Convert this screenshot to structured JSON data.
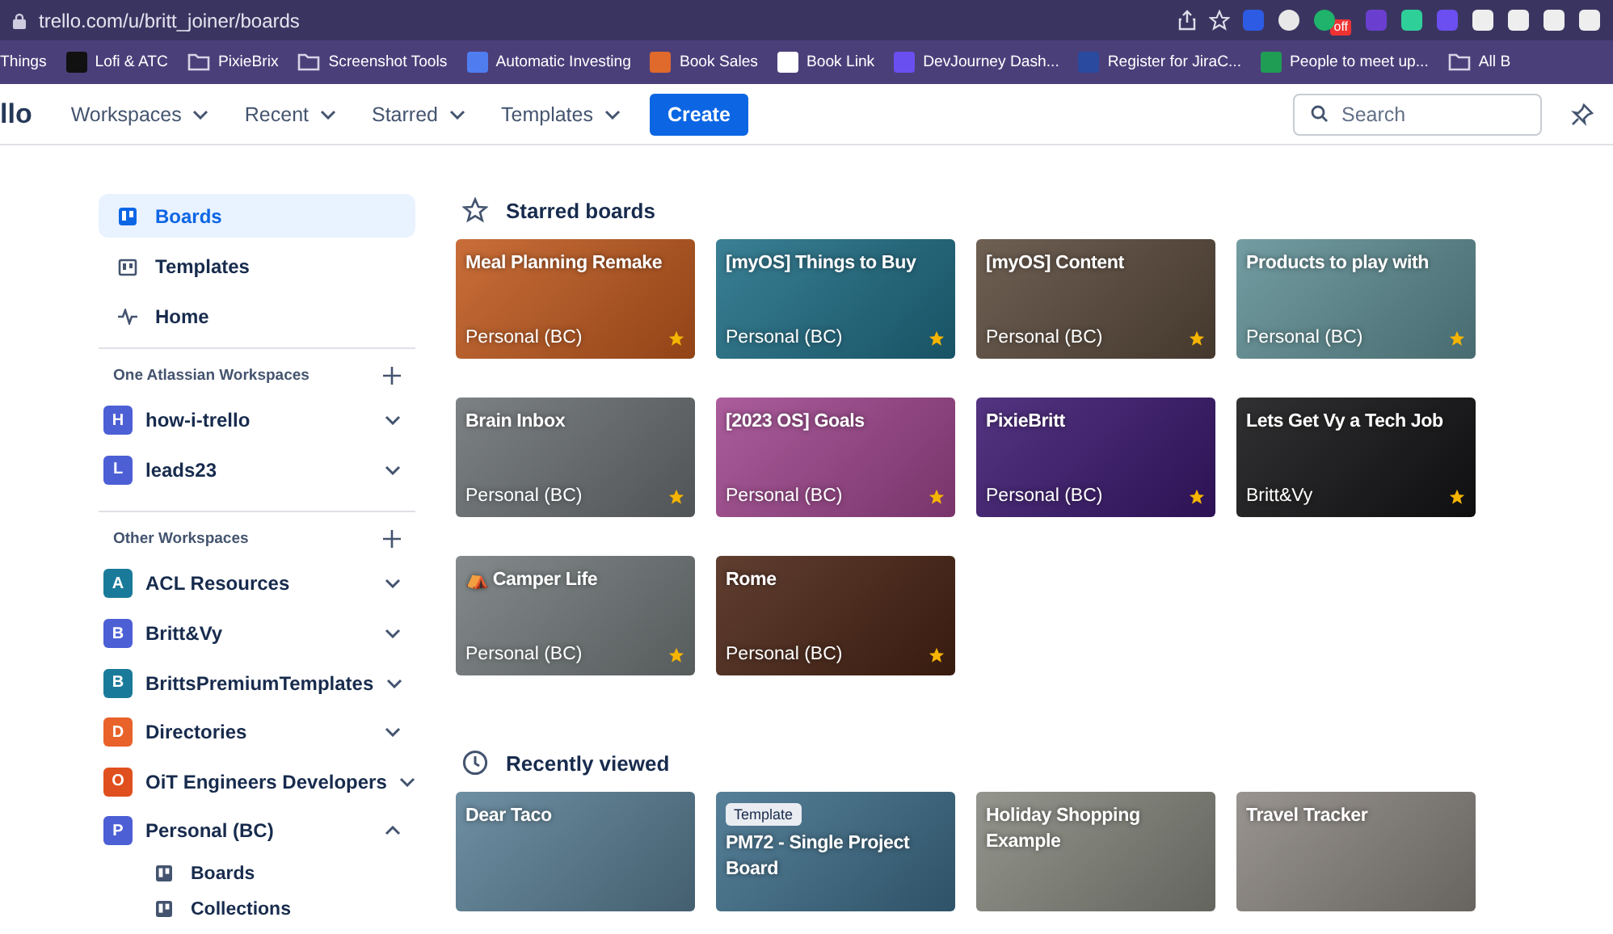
{
  "browser": {
    "url": "trello.com/u/britt_joiner/boards",
    "extension_badge": "off"
  },
  "bookmarks": [
    {
      "label": "Things",
      "kind": "plain"
    },
    {
      "label": "Lofi & ATC",
      "kind": "site",
      "color": "#111111"
    },
    {
      "label": "PixieBrix",
      "kind": "folder",
      "color": "#d8d4e6"
    },
    {
      "label": "Screenshot Tools",
      "kind": "folder",
      "color": "#d8d4e6"
    },
    {
      "label": "Automatic Investing",
      "kind": "site",
      "color": "#4f7df0"
    },
    {
      "label": "Book Sales",
      "kind": "site",
      "color": "#e0692c"
    },
    {
      "label": "Book Link",
      "kind": "site",
      "color": "#ffffff"
    },
    {
      "label": "DevJourney Dash...",
      "kind": "site",
      "color": "#6a4ff0"
    },
    {
      "label": "Register for JiraC...",
      "kind": "site",
      "color": "#2a4aa0"
    },
    {
      "label": "People to meet up...",
      "kind": "site",
      "color": "#1f9d55"
    },
    {
      "label": "All B",
      "kind": "folder",
      "color": "#d8d4e6"
    }
  ],
  "nav": {
    "logo": "llo",
    "menus": [
      "Workspaces",
      "Recent",
      "Starred",
      "Templates"
    ],
    "create": "Create",
    "search": {
      "placeholder": "Search"
    }
  },
  "sidebar": {
    "items": [
      {
        "label": "Boards",
        "kind": "boards",
        "selected": true
      },
      {
        "label": "Templates",
        "kind": "templates",
        "selected": false
      },
      {
        "label": "Home",
        "kind": "home",
        "selected": false
      }
    ],
    "sections": [
      {
        "title": "One Atlassian Workspaces",
        "workspaces": [
          {
            "letter": "H",
            "name": "how-i-trello",
            "color": "#4c5fd5",
            "expanded": false
          },
          {
            "letter": "L",
            "name": "leads23",
            "color": "#4c5fd5",
            "expanded": false
          }
        ]
      },
      {
        "title": "Other Workspaces",
        "workspaces": [
          {
            "letter": "A",
            "name": "ACL Resources",
            "color": "#1a7a9a",
            "expanded": false
          },
          {
            "letter": "B",
            "name": "Britt&Vy",
            "color": "#4c5fd5",
            "expanded": false
          },
          {
            "letter": "B",
            "name": "BrittsPremiumTemplates",
            "color": "#1a7a9a",
            "expanded": false
          },
          {
            "letter": "D",
            "name": "Directories",
            "color": "#e8622a",
            "expanded": false
          },
          {
            "letter": "O",
            "name": "OiT Engineers Developers",
            "color": "#e0501e",
            "expanded": false
          },
          {
            "letter": "P",
            "name": "Personal (BC)",
            "color": "#4c5fd5",
            "expanded": true,
            "children": [
              {
                "label": "Boards"
              },
              {
                "label": "Collections"
              }
            ]
          }
        ]
      }
    ]
  },
  "starred_boards": {
    "title": "Starred boards",
    "boards": [
      {
        "title": "Meal Planning Remake",
        "workspace": "Personal (BC)",
        "starred": true,
        "color": "#c25a1e"
      },
      {
        "title": "[myOS] Things to Buy",
        "workspace": "Personal (BC)",
        "starred": true,
        "color": "#1f6e86"
      },
      {
        "title": "[myOS] Content",
        "workspace": "Personal (BC)",
        "starred": true,
        "color": "#5b4a3c"
      },
      {
        "title": "Products to play with",
        "workspace": "Personal (BC)",
        "starred": true,
        "color": "#5f8f95"
      },
      {
        "title": "Brain Inbox",
        "workspace": "Personal (BC)",
        "starred": true,
        "color": "#6b7073"
      },
      {
        "title": "[2023 OS] Goals",
        "workspace": "Personal (BC)",
        "starred": true,
        "color": "#a0468e"
      },
      {
        "title": "PixieBritt",
        "workspace": "Personal (BC)",
        "starred": true,
        "color": "#3b1870"
      },
      {
        "title": "Lets Get Vy a Tech Job",
        "workspace": "Britt&Vy",
        "starred": true,
        "color": "#141416"
      },
      {
        "title": "⛺ Camper Life",
        "workspace": "Personal (BC)",
        "starred": true,
        "color": "#737a7b"
      },
      {
        "title": "Rome",
        "workspace": "Personal (BC)",
        "starred": true,
        "color": "#4a2414"
      }
    ]
  },
  "recently_viewed": {
    "title": "Recently viewed",
    "boards": [
      {
        "title": "Dear Taco",
        "color": "#5a7f95"
      },
      {
        "title": "PM72 - Single Project Board",
        "badge": "Template",
        "color": "#3e6e8a"
      },
      {
        "title": "Holiday Shopping Example",
        "color": "#85877d"
      },
      {
        "title": "Travel Tracker",
        "color": "#8a8580"
      }
    ]
  }
}
